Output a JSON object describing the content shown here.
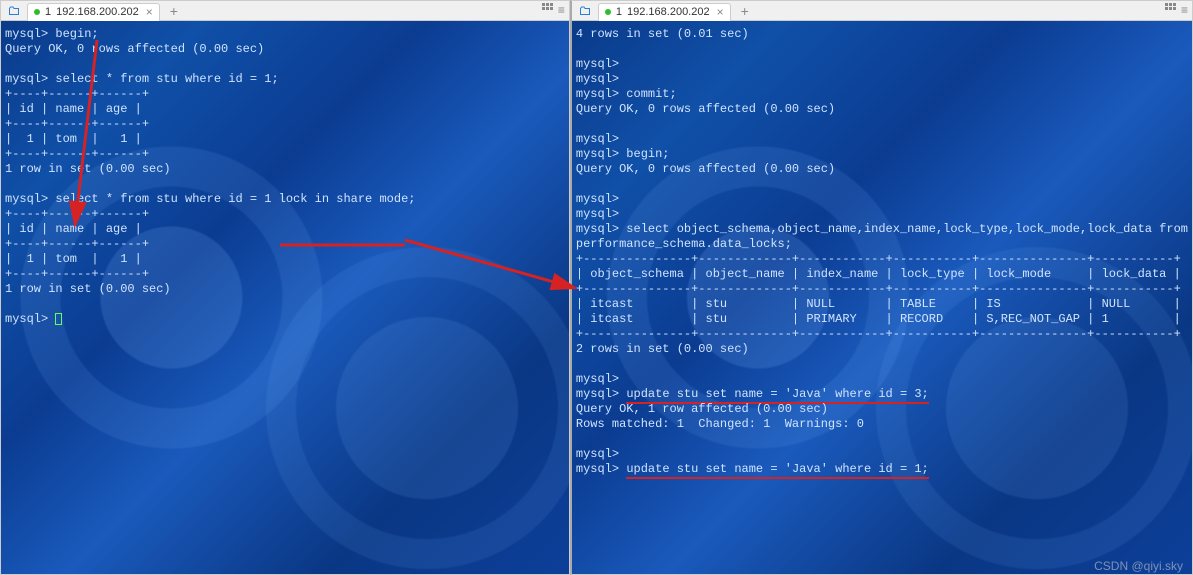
{
  "left": {
    "tab": {
      "index": "1",
      "title": "192.168.200.202"
    },
    "lines": [
      "mysql> begin;",
      "Query OK, 0 rows affected (0.00 sec)",
      "",
      "mysql> select * from stu where id = 1;",
      "+----+------+------+",
      "| id | name | age |",
      "+----+------+------+",
      "|  1 | tom  |   1 |",
      "+----+------+------+",
      "1 row in set (0.00 sec)",
      "",
      "mysql> select * from stu where id = 1 lock in share mode;",
      "+----+------+------+",
      "| id | name | age |",
      "+----+------+------+",
      "|  1 | tom  |   1 |",
      "+----+------+------+",
      "1 row in set (0.00 sec)",
      "",
      "mysql> "
    ],
    "highlighted_sql": "select * from stu where id = 1 lock in share mode;"
  },
  "right": {
    "tab": {
      "index": "1",
      "title": "192.168.200.202"
    },
    "lines_top": [
      "4 rows in set (0.01 sec)",
      "",
      "mysql>",
      "mysql>",
      "mysql> commit;",
      "Query OK, 0 rows affected (0.00 sec)",
      "",
      "mysql>",
      "mysql> begin;",
      "Query OK, 0 rows affected (0.00 sec)",
      "",
      "mysql>",
      "mysql>",
      "mysql> select object_schema,object_name,index_name,lock_type,lock_mode,lock_data from",
      "performance_schema.data_locks;"
    ],
    "table_header": "| object_schema | object_name | index_name | lock_type | lock_mode     | lock_data |",
    "table_rows": [
      "| itcast        | stu         | NULL       | TABLE     | IS            | NULL      |",
      "| itcast        | stu         | PRIMARY    | RECORD    | S,REC_NOT_GAP | 1         |"
    ],
    "table_sep": "+---------------+-------------+------------+-----------+---------------+-----------+",
    "lines_mid": [
      "2 rows in set (0.00 sec)",
      "",
      "mysql>"
    ],
    "update1_prefix": "mysql> ",
    "update1_sql": "update stu set name = 'Java' where id = 3;",
    "lines_after_update1": [
      "Query OK, 1 row affected (0.00 sec)",
      "Rows matched: 1  Changed: 1  Warnings: 0",
      "",
      "mysql>"
    ],
    "update2_prefix": "mysql> ",
    "update2_sql": "update stu set name = 'Java' where id = 1;"
  },
  "watermark": "CSDN @qiyi.sky"
}
